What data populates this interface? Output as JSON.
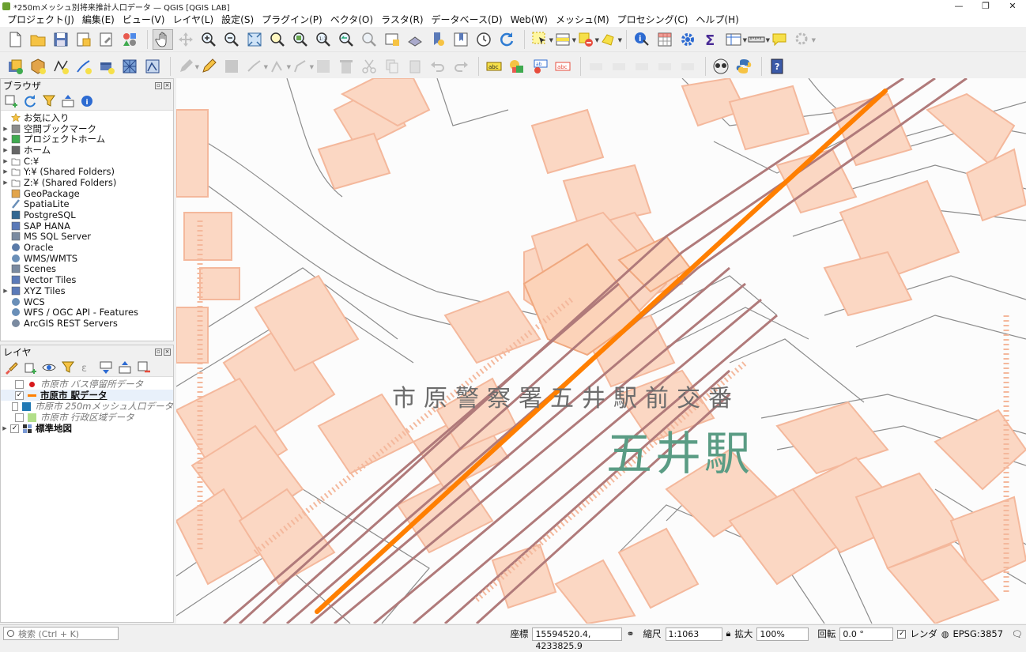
{
  "window": {
    "title": "*250mメッシュ別将来推計人口データ — QGIS [QGIS LAB]",
    "controls": [
      "—",
      "❐",
      "✕"
    ]
  },
  "menu": [
    "プロジェクト(J)",
    "編集(E)",
    "ビュー(V)",
    "レイヤ(L)",
    "設定(S)",
    "プラグイン(P)",
    "ベクタ(O)",
    "ラスタ(R)",
    "データベース(D)",
    "Web(W)",
    "メッシュ(M)",
    "プロセシング(C)",
    "ヘルプ(H)"
  ],
  "browser": {
    "title": "ブラウザ",
    "items": [
      {
        "label": "お気に入り",
        "icon": "star-icon",
        "expand": false
      },
      {
        "label": "空間ブックマーク",
        "icon": "bookmark-icon",
        "expand": true
      },
      {
        "label": "プロジェクトホーム",
        "icon": "project-home-icon",
        "expand": true
      },
      {
        "label": "ホーム",
        "icon": "home-icon",
        "expand": true
      },
      {
        "label": "C:¥",
        "icon": "folder-icon",
        "expand": true
      },
      {
        "label": "Y:¥ (Shared Folders)",
        "icon": "folder-icon",
        "expand": true
      },
      {
        "label": "Z:¥ (Shared Folders)",
        "icon": "folder-icon",
        "expand": true
      },
      {
        "label": "GeoPackage",
        "icon": "geopackage-icon",
        "expand": false
      },
      {
        "label": "SpatiaLite",
        "icon": "spatialite-icon",
        "expand": false
      },
      {
        "label": "PostgreSQL",
        "icon": "postgresql-icon",
        "expand": false
      },
      {
        "label": "SAP HANA",
        "icon": "sap-hana-icon",
        "expand": false
      },
      {
        "label": "MS SQL Server",
        "icon": "mssql-icon",
        "expand": false
      },
      {
        "label": "Oracle",
        "icon": "oracle-icon",
        "expand": false
      },
      {
        "label": "WMS/WMTS",
        "icon": "wms-icon",
        "expand": false
      },
      {
        "label": "Scenes",
        "icon": "scenes-icon",
        "expand": false
      },
      {
        "label": "Vector Tiles",
        "icon": "vector-tiles-icon",
        "expand": false
      },
      {
        "label": "XYZ Tiles",
        "icon": "xyz-tiles-icon",
        "expand": true
      },
      {
        "label": "WCS",
        "icon": "wcs-icon",
        "expand": false
      },
      {
        "label": "WFS / OGC API - Features",
        "icon": "wfs-icon",
        "expand": false
      },
      {
        "label": "ArcGIS REST Servers",
        "icon": "arcgis-icon",
        "expand": false
      }
    ]
  },
  "layers": {
    "title": "レイヤ",
    "items": [
      {
        "label": "市原市 バス停留所データ",
        "checked": false,
        "symbol": "point",
        "color": "#d7191c",
        "active": false
      },
      {
        "label": "市原市 駅データ",
        "checked": true,
        "symbol": "line",
        "color": "#ff7f00",
        "active": true
      },
      {
        "label": "市原市 250mメッシュ人口データ",
        "checked": false,
        "symbol": "fill",
        "color": "#1f78b4",
        "active": false
      },
      {
        "label": "市原市 行政区域データ",
        "checked": false,
        "symbol": "fill",
        "color": "#b2df8a",
        "active": false
      },
      {
        "label": "標準地図",
        "checked": true,
        "symbol": "raster",
        "color": "#333333",
        "active": false
      }
    ]
  },
  "map": {
    "label_police": "市原警察署五井駅前交番",
    "label_station": "五井駅",
    "colors": {
      "building": "#fbd7c3",
      "building_edge": "#f4b89c",
      "rail": "#b07a7a",
      "station_line": "#ff7f00",
      "text_station": "#5a9c84"
    }
  },
  "status": {
    "search_placeholder": "検索 (Ctrl + K)",
    "coord_label": "座標",
    "coord_value": "15594520.4, 4233825.9",
    "scale_label": "縮尺",
    "scale_value": "1:1063",
    "magnifier_label": "拡大",
    "magnifier_value": "100%",
    "rotation_label": "回転",
    "rotation_value": "0.0 °",
    "render_label": "レンダ",
    "crs": "EPSG:3857"
  }
}
